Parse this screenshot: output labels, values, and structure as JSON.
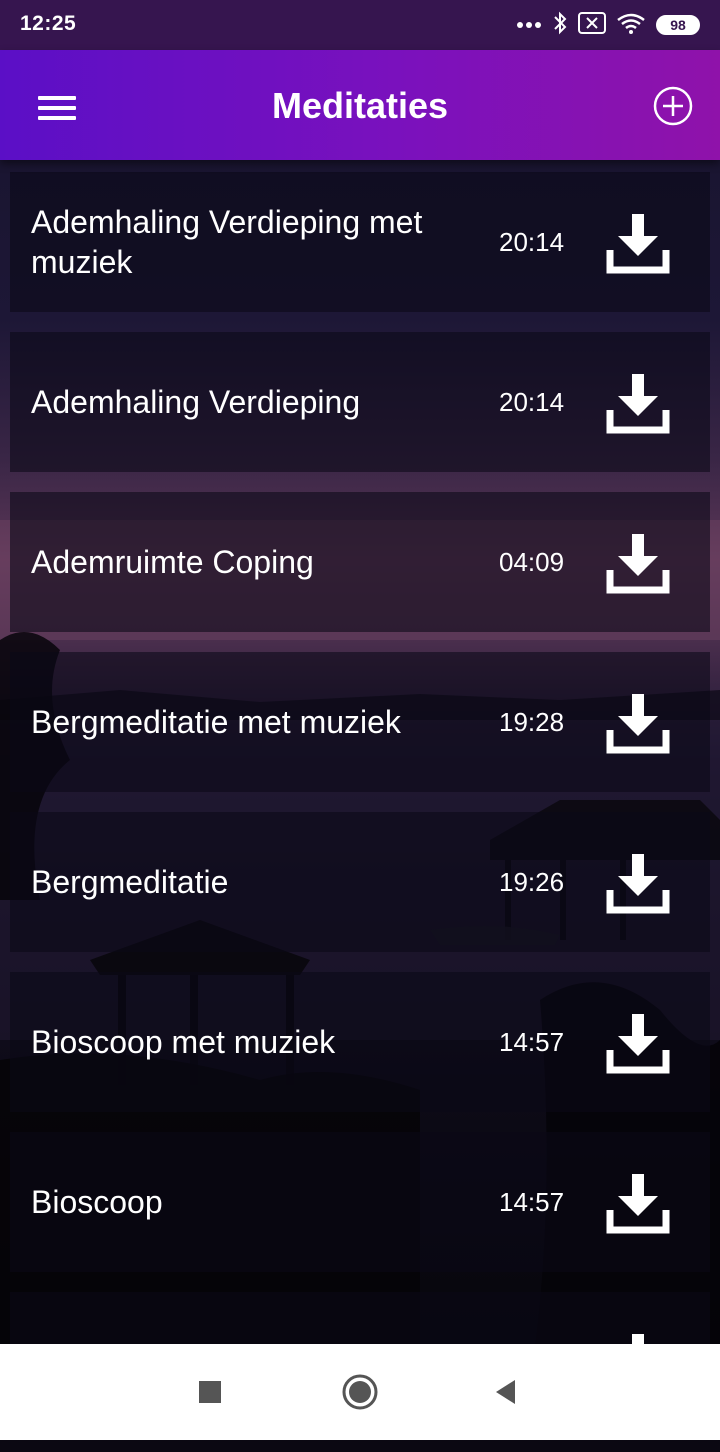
{
  "status_bar": {
    "time": "12:25",
    "battery": "98",
    "icons": [
      "more-dots-icon",
      "bluetooth-icon",
      "sim-x-icon",
      "wifi-icon",
      "battery-icon"
    ]
  },
  "app_bar": {
    "title": "Meditaties",
    "menu_icon": "hamburger-menu-icon",
    "add_icon": "plus-circle-icon"
  },
  "meditations": [
    {
      "title": "Ademhaling Verdieping met muziek",
      "duration": "20:14"
    },
    {
      "title": "Ademhaling Verdieping",
      "duration": "20:14"
    },
    {
      "title": "Ademruimte Coping",
      "duration": "04:09"
    },
    {
      "title": "Bergmeditatie met muziek",
      "duration": "19:28"
    },
    {
      "title": "Bergmeditatie",
      "duration": "19:26"
    },
    {
      "title": "Bioscoop met muziek",
      "duration": "14:57"
    },
    {
      "title": "Bioscoop",
      "duration": "14:57"
    },
    {
      "title": "",
      "duration": ""
    }
  ],
  "nav_bar": {
    "recents_icon": "square-recents-icon",
    "home_icon": "circle-home-icon",
    "back_icon": "triangle-back-icon"
  },
  "colors": {
    "status_bar": "#36154f",
    "app_bar_start": "#5b0fc6",
    "app_bar_end": "#8f12aa",
    "text": "#ffffff",
    "nav_bar": "#ffffff"
  }
}
